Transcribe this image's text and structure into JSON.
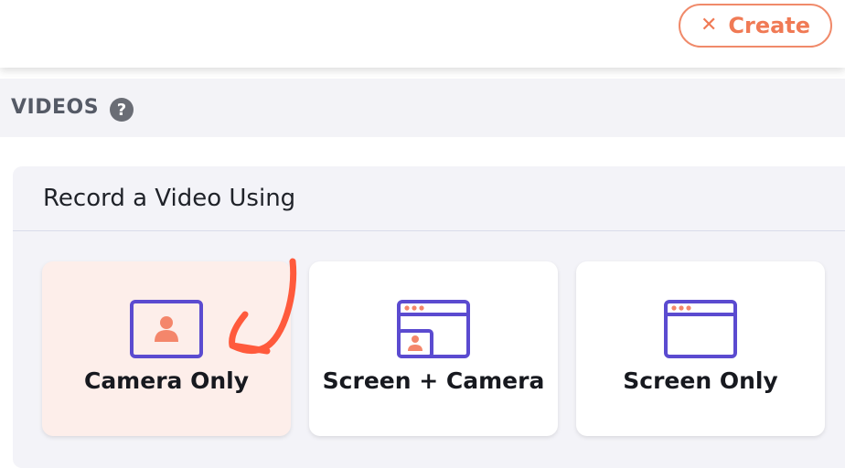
{
  "header": {
    "create_button": {
      "label": "Create",
      "icon": "close-icon"
    }
  },
  "videos": {
    "title": "VIDEOS",
    "help_icon": "?"
  },
  "record_panel": {
    "title": "Record a Video Using",
    "options": [
      {
        "label": "Camera Only",
        "icon": "camera-person-icon",
        "selected": true
      },
      {
        "label": "Screen + Camera",
        "icon": "screen-camera-icon",
        "selected": false
      },
      {
        "label": "Screen Only",
        "icon": "screen-window-icon",
        "selected": false
      }
    ]
  },
  "colors": {
    "accent": "#f07a55",
    "icon_stroke": "#5b4bd0",
    "selected_card": "#fdeeea",
    "arrow": "#ff5a3c"
  }
}
